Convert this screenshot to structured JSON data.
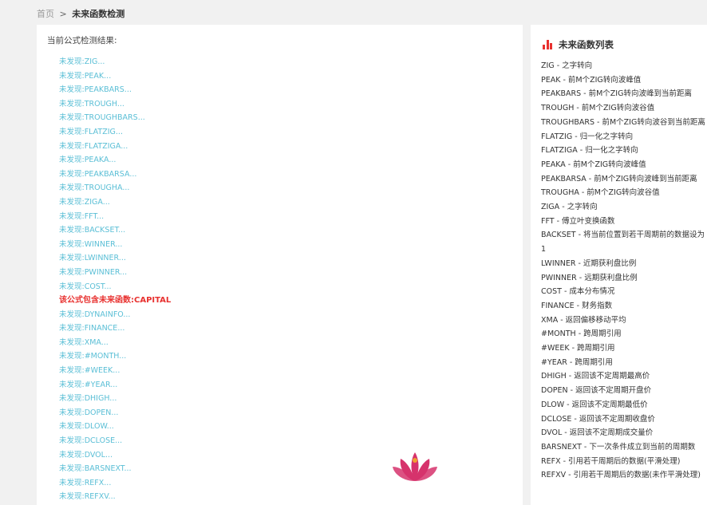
{
  "breadcrumb": {
    "home": "首页",
    "separator": ">",
    "current": "未来函数检测"
  },
  "result": {
    "title": "当前公式检测结果:",
    "items": [
      {
        "text": "未发现:ZIG...",
        "alert": false
      },
      {
        "text": "未发现:PEAK...",
        "alert": false
      },
      {
        "text": "未发现:PEAKBARS...",
        "alert": false
      },
      {
        "text": "未发现:TROUGH...",
        "alert": false
      },
      {
        "text": "未发现:TROUGHBARS...",
        "alert": false
      },
      {
        "text": "未发现:FLATZIG...",
        "alert": false
      },
      {
        "text": "未发现:FLATZIGA...",
        "alert": false
      },
      {
        "text": "未发现:PEAKA...",
        "alert": false
      },
      {
        "text": "未发现:PEAKBARSA...",
        "alert": false
      },
      {
        "text": "未发现:TROUGHA...",
        "alert": false
      },
      {
        "text": "未发现:ZIGA...",
        "alert": false
      },
      {
        "text": "未发现:FFT...",
        "alert": false
      },
      {
        "text": "未发现:BACKSET...",
        "alert": false
      },
      {
        "text": "未发现:WINNER...",
        "alert": false
      },
      {
        "text": "未发现:LWINNER...",
        "alert": false
      },
      {
        "text": "未发现:PWINNER...",
        "alert": false
      },
      {
        "text": "未发现:COST...",
        "alert": false
      },
      {
        "text": "该公式包含未来函数:CAPITAL",
        "alert": true
      },
      {
        "text": "未发现:DYNAINFO...",
        "alert": false
      },
      {
        "text": "未发现:FINANCE...",
        "alert": false
      },
      {
        "text": "未发现:XMA...",
        "alert": false
      },
      {
        "text": "未发现:#MONTH...",
        "alert": false
      },
      {
        "text": "未发现:#WEEK...",
        "alert": false
      },
      {
        "text": "未发现:#YEAR...",
        "alert": false
      },
      {
        "text": "未发现:DHIGH...",
        "alert": false
      },
      {
        "text": "未发现:DOPEN...",
        "alert": false
      },
      {
        "text": "未发现:DLOW...",
        "alert": false
      },
      {
        "text": "未发现:DCLOSE...",
        "alert": false
      },
      {
        "text": "未发现:DVOL...",
        "alert": false
      },
      {
        "text": "未发现:BARSNEXT...",
        "alert": false
      },
      {
        "text": "未发现:REFX...",
        "alert": false
      },
      {
        "text": "未发现:REFXV...",
        "alert": false
      }
    ]
  },
  "future_functions": {
    "title": "未来函数列表",
    "icon": "bar-chart-icon",
    "accent_color": "#e8312f",
    "items": [
      "ZIG - 之字转向",
      "PEAK - 前M个ZIG转向波峰值",
      "PEAKBARS - 前M个ZIG转向波峰到当前距离",
      "TROUGH - 前M个ZIG转向波谷值",
      "TROUGHBARS - 前M个ZIG转向波谷到当前距离",
      "FLATZIG - 归一化之字转向",
      "FLATZIGA - 归一化之字转向",
      "PEAKA - 前M个ZIG转向波峰值",
      "PEAKBARSA - 前M个ZIG转向波峰到当前距离",
      "TROUGHA - 前M个ZIG转向波谷值",
      "ZIGA - 之字转向",
      "FFT - 傅立叶变换函数",
      "BACKSET - 将当前位置到若干周期前的数据设为1",
      "LWINNER - 近期获利盘比例",
      "PWINNER - 远期获利盘比例",
      "COST - 成本分布情况",
      "FINANCE - 财务指数",
      "XMA - 返回偏移移动平均",
      "#MONTH - 跨周期引用",
      "#WEEK - 跨周期引用",
      "#YEAR - 跨周期引用",
      "DHIGH - 返回该不定周期最高价",
      "DOPEN - 返回该不定周期开盘价",
      "DLOW - 返回该不定周期最低价",
      "DCLOSE - 返回该不定周期收盘价",
      "DVOL - 返回该不定周期成交量价",
      "BARSNEXT - 下一次条件成立到当前的周期数",
      "REFX - 引用若干周期后的数据(平滑处理)",
      "REFXV - 引用若干周期后的数据(未作平滑处理)"
    ]
  },
  "logo": {
    "icon": "lotus-logo-icon",
    "colors": [
      "#d6336c",
      "#f0a030"
    ]
  }
}
